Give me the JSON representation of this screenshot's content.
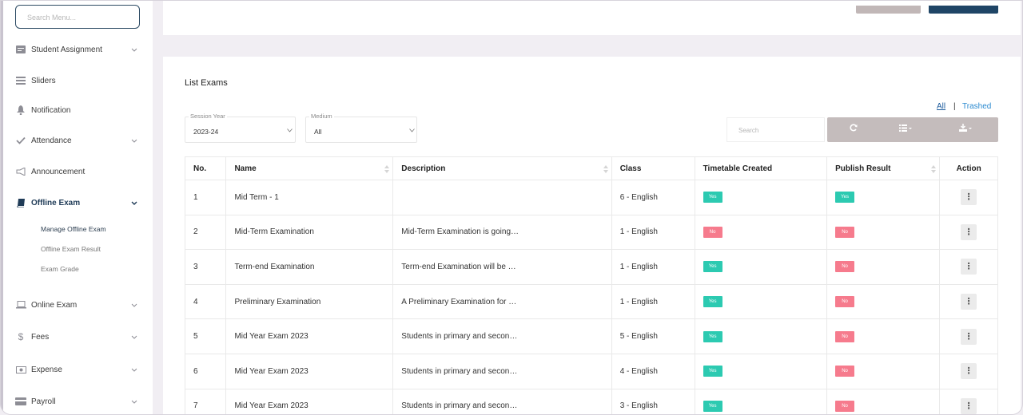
{
  "sidebar": {
    "search_placeholder": "Search Menu...",
    "items": [
      {
        "label": "Student Assignment",
        "icon": "assignment-icon",
        "expandable": true
      },
      {
        "label": "Sliders",
        "icon": "sliders-icon",
        "expandable": false
      },
      {
        "label": "Notification",
        "icon": "bell-icon",
        "expandable": false
      },
      {
        "label": "Attendance",
        "icon": "check-icon",
        "expandable": true
      },
      {
        "label": "Announcement",
        "icon": "megaphone-icon",
        "expandable": false
      },
      {
        "label": "Offline Exam",
        "icon": "book-icon",
        "expandable": true,
        "active": true
      },
      {
        "label": "Online Exam",
        "icon": "laptop-icon",
        "expandable": true
      },
      {
        "label": "Fees",
        "icon": "dollar-icon",
        "expandable": true
      },
      {
        "label": "Expense",
        "icon": "money-icon",
        "expandable": true
      },
      {
        "label": "Payroll",
        "icon": "payroll-icon",
        "expandable": true
      }
    ],
    "subitems": [
      {
        "label": "Manage Offline Exam",
        "active": true
      },
      {
        "label": "Offline Exam Result",
        "active": false
      },
      {
        "label": "Exam Grade",
        "active": false
      }
    ]
  },
  "main": {
    "title": "List Exams",
    "links": {
      "all": "All",
      "separator": "|",
      "trashed": "Trashed"
    },
    "filters": {
      "session_year": {
        "label": "Session Year",
        "value": "2023-24"
      },
      "medium": {
        "label": "Medium",
        "value": "All"
      }
    },
    "search_placeholder": "Search",
    "table": {
      "headers": [
        "No.",
        "Name",
        "Description",
        "Class",
        "Timetable Created",
        "Publish Result",
        "Action"
      ],
      "rows": [
        {
          "no": "1",
          "name": "Mid Term - 1",
          "description": "",
          "class": "6 - English",
          "timetable": "Yes",
          "publish": "Yes"
        },
        {
          "no": "2",
          "name": "Mid-Term Examination",
          "description": "Mid-Term Examination is going…",
          "class": "1 - English",
          "timetable": "No",
          "publish": "No"
        },
        {
          "no": "3",
          "name": "Term-end Examination",
          "description": "Term-end Examination will be …",
          "class": "1 - English",
          "timetable": "Yes",
          "publish": "No"
        },
        {
          "no": "4",
          "name": "Preliminary Examination",
          "description": "A Preliminary Examination for …",
          "class": "1 - English",
          "timetable": "Yes",
          "publish": "No"
        },
        {
          "no": "5",
          "name": "Mid Year Exam 2023",
          "description": "Students in primary and secon…",
          "class": "5 - English",
          "timetable": "Yes",
          "publish": "No"
        },
        {
          "no": "6",
          "name": "Mid Year Exam 2023",
          "description": "Students in primary and secon…",
          "class": "4 - English",
          "timetable": "Yes",
          "publish": "No"
        },
        {
          "no": "7",
          "name": "Mid Year Exam 2023",
          "description": "Students in primary and secon…",
          "class": "3 - English",
          "timetable": "Yes",
          "publish": "No"
        }
      ]
    }
  },
  "colors": {
    "accent_navy": "#1f4566",
    "badge_yes": "#2ccab1",
    "badge_no": "#f67b8d",
    "link_blue": "#2b8ad0"
  }
}
